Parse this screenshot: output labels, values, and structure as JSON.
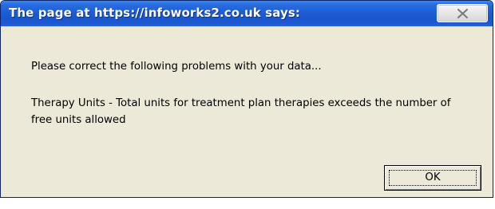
{
  "window": {
    "title": "The page at https://infoworks2.co.uk says:",
    "close_icon": "close-x-icon"
  },
  "message": {
    "line1": "Please correct the following problems with your data...",
    "line2": "Therapy Units - Total units for treatment plan therapies exceeds the number of free units allowed"
  },
  "buttons": {
    "ok_label": "OK"
  }
}
